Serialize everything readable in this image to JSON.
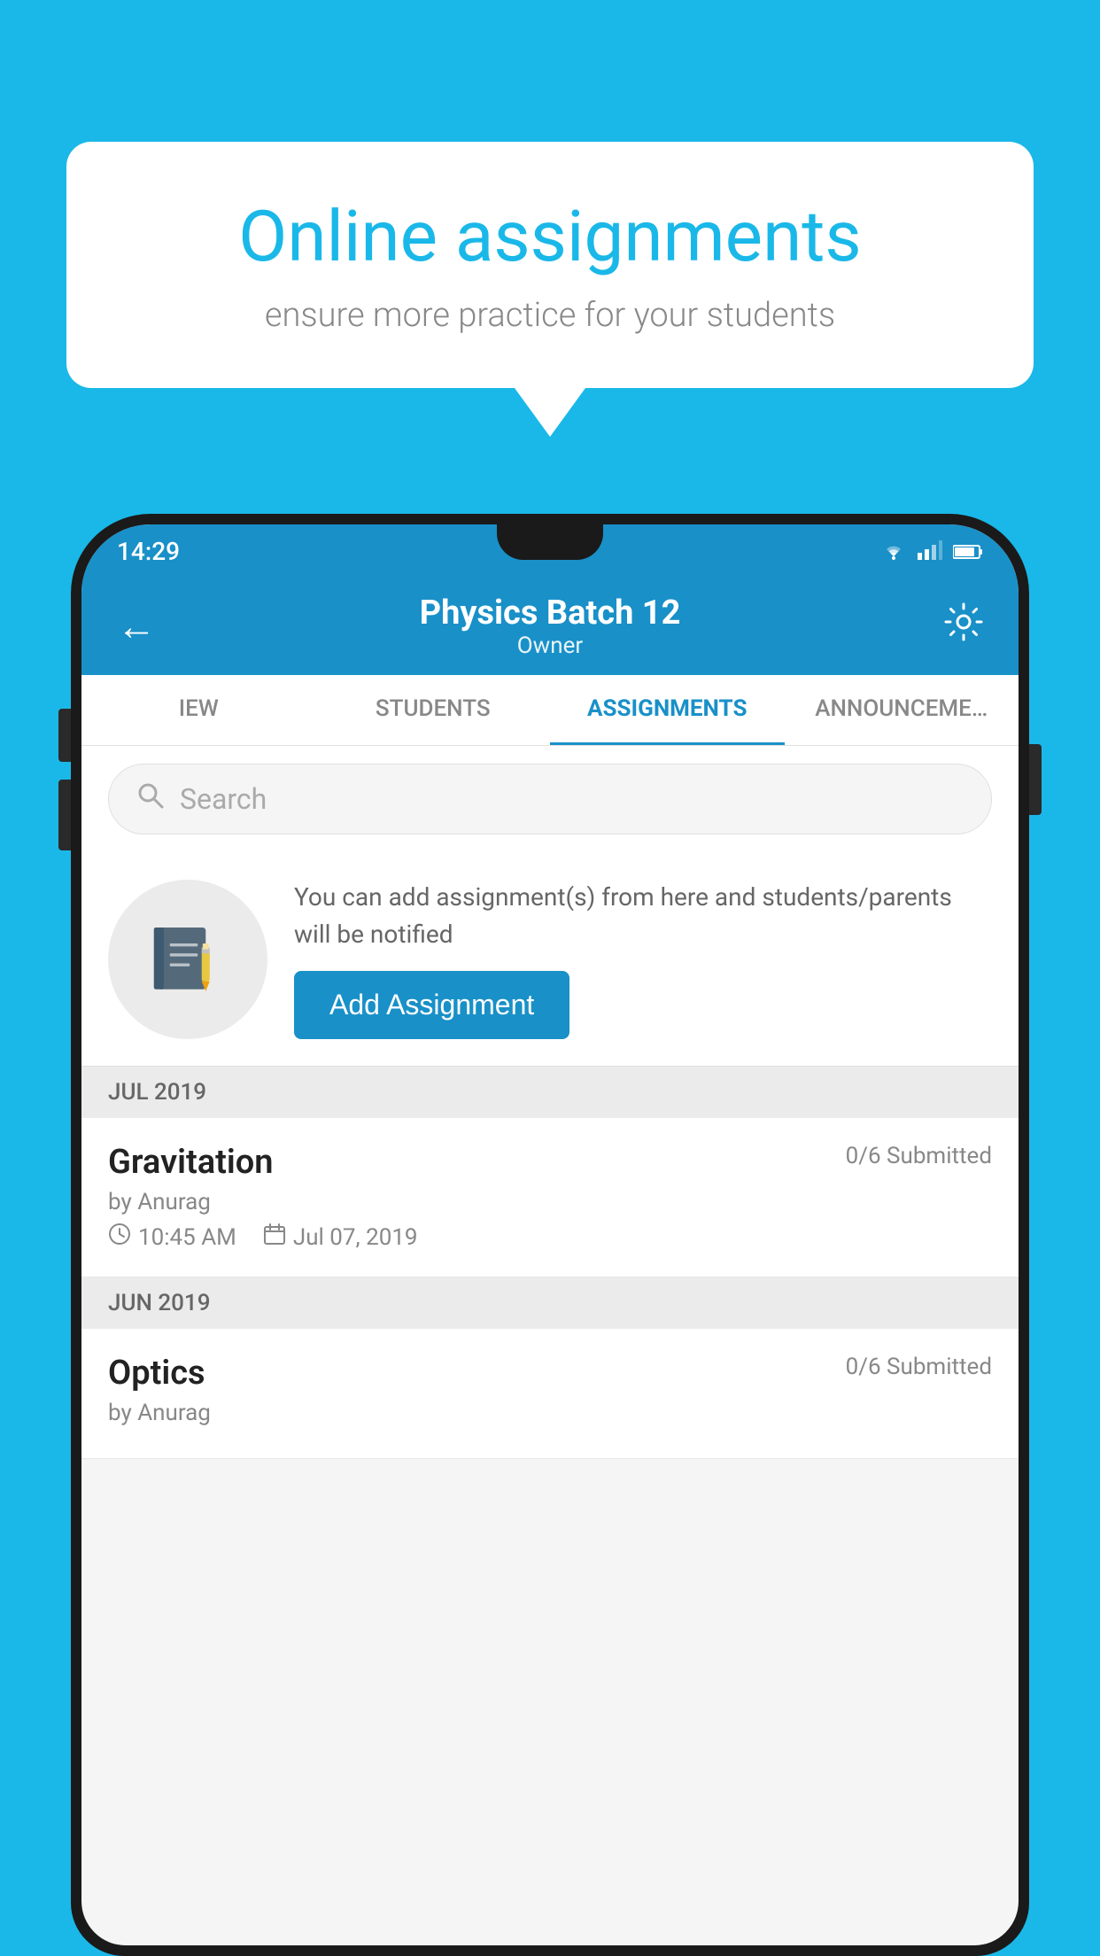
{
  "background_color": "#1ab8e8",
  "speech_bubble": {
    "title": "Online assignments",
    "subtitle": "ensure more practice for your students"
  },
  "status_bar": {
    "time": "14:29",
    "wifi_icon": "wifi-icon",
    "signal_icon": "signal-icon",
    "battery_icon": "battery-icon"
  },
  "header": {
    "back_icon": "←",
    "title": "Physics Batch 12",
    "subtitle": "Owner",
    "gear_icon": "⚙"
  },
  "tabs": [
    {
      "label": "IEW",
      "active": false
    },
    {
      "label": "STUDENTS",
      "active": false
    },
    {
      "label": "ASSIGNMENTS",
      "active": true
    },
    {
      "label": "ANNOUNCEMENTS",
      "active": false
    }
  ],
  "search": {
    "placeholder": "Search",
    "icon": "🔍"
  },
  "add_assignment_section": {
    "description": "You can add assignment(s) from here and students/parents will be notified",
    "button_label": "Add Assignment"
  },
  "sections": [
    {
      "header": "JUL 2019",
      "assignments": [
        {
          "name": "Gravitation",
          "submitted": "0/6 Submitted",
          "author": "by Anurag",
          "time": "10:45 AM",
          "date": "Jul 07, 2019"
        }
      ]
    },
    {
      "header": "JUN 2019",
      "assignments": [
        {
          "name": "Optics",
          "submitted": "0/6 Submitted",
          "author": "by Anurag",
          "time": "",
          "date": ""
        }
      ]
    }
  ]
}
